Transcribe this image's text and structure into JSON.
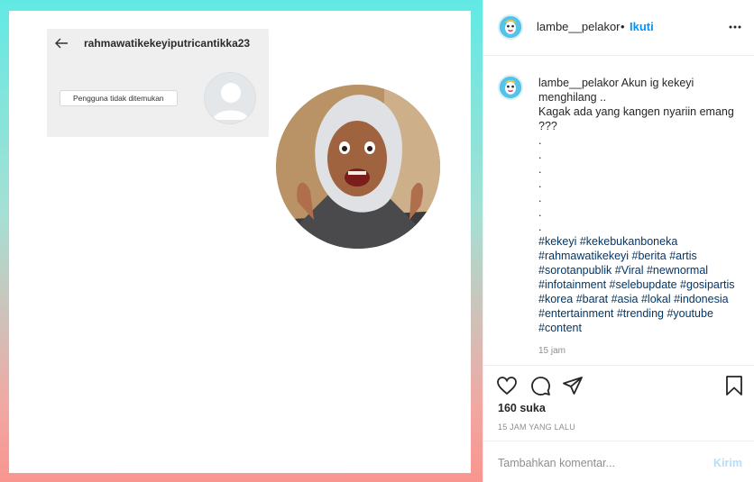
{
  "post_image": {
    "search_screenshot": {
      "username": "rahmawatikekeyiputricantikka23",
      "status_label": "Pengguna tidak ditemukan"
    }
  },
  "header": {
    "username": "lambe__pelakor",
    "separator": "•",
    "follow_label": "Ikuti"
  },
  "caption": {
    "username": "lambe__pelakor",
    "text": " Akun ig kekeyi menghilang ..\nKagak ada yang kangen nyariin emang ???\n.\n.\n.\n.\n.\n.\n.",
    "hashtags": "#kekeyi #kekebukanboneka #rahmawatikekeyi #berita #artis #sorotanpublik #Viral #newnormal #infotainment #selebupdate #gosipartis #korea #barat #asia #lokal #indonesia #entertainment #trending #youtube #content",
    "time": "15 jam"
  },
  "actions": {
    "likes": "160 suka",
    "date": "15 JAM YANG LALU"
  },
  "comment": {
    "placeholder": "Tambahkan komentar...",
    "post_label": "Kirim"
  },
  "colors": {
    "accent_blue": "#0095f6",
    "hashtag": "#00376b",
    "gradient_top": "#62e9e4",
    "gradient_bottom": "#f8958f"
  },
  "icons": [
    "back-arrow-icon",
    "more-options-icon",
    "heart-icon",
    "comment-icon",
    "share-icon",
    "bookmark-icon"
  ]
}
